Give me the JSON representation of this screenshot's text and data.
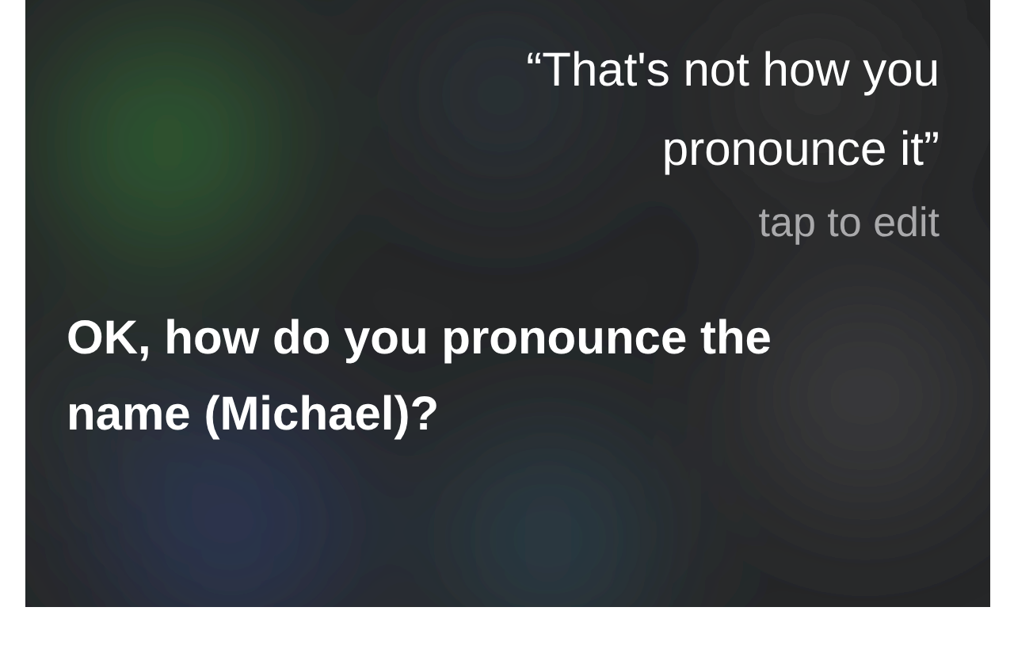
{
  "user_utterance": {
    "text": "“That's not how you pronounce it”",
    "hint": "tap to edit"
  },
  "reply": {
    "text": "OK, how do you pronounce the name (Michael)?"
  }
}
